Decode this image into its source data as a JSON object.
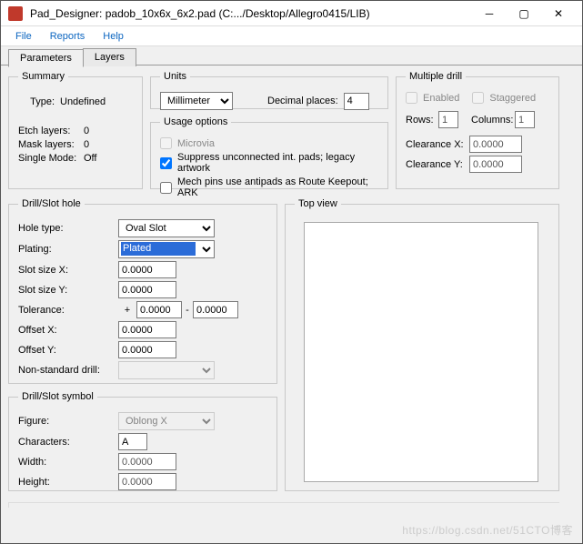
{
  "window": {
    "title": "Pad_Designer: padob_10x6x_6x2.pad (C:.../Desktop/Allegro0415/LIB)"
  },
  "menu": {
    "file": "File",
    "reports": "Reports",
    "help": "Help"
  },
  "tabs": {
    "parameters": "Parameters",
    "layers": "Layers"
  },
  "summary": {
    "legend": "Summary",
    "type_lbl": "Type:",
    "type_val": "Undefined",
    "etch_lbl": "Etch layers:",
    "etch_val": "0",
    "mask_lbl": "Mask layers:",
    "mask_val": "0",
    "single_lbl": "Single Mode:",
    "single_val": "Off"
  },
  "units": {
    "legend": "Units",
    "unit_val": "Millimeter",
    "dec_lbl": "Decimal places:",
    "dec_val": "4"
  },
  "usage": {
    "legend": "Usage options",
    "microvia": "Microvia",
    "suppress": "Suppress unconnected int. pads; legacy artwork",
    "mech": "Mech pins use antipads as Route Keepout; ARK"
  },
  "multi": {
    "legend": "Multiple drill",
    "enabled": "Enabled",
    "staggered": "Staggered",
    "rows_lbl": "Rows:",
    "rows_val": "1",
    "cols_lbl": "Columns:",
    "cols_val": "1",
    "clx_lbl": "Clearance X:",
    "clx_val": "0.0000",
    "cly_lbl": "Clearance Y:",
    "cly_val": "0.0000"
  },
  "drill": {
    "legend": "Drill/Slot hole",
    "hole_lbl": "Hole type:",
    "hole_val": "Oval Slot",
    "plating_lbl": "Plating:",
    "plating_val": "Plated",
    "sx_lbl": "Slot size X:",
    "sx_val": "0.0000",
    "sy_lbl": "Slot size Y:",
    "sy_val": "0.0000",
    "tol_lbl": "Tolerance:",
    "tol_plus": "+",
    "tol_p_val": "0.0000",
    "tol_dash": "-",
    "tol_m_val": "0.0000",
    "ox_lbl": "Offset X:",
    "ox_val": "0.0000",
    "oy_lbl": "Offset Y:",
    "oy_val": "0.0000",
    "nsd_lbl": "Non-standard drill:"
  },
  "symbol": {
    "legend": "Drill/Slot symbol",
    "figure_lbl": "Figure:",
    "figure_val": "Oblong X",
    "chars_lbl": "Characters:",
    "chars_val": "A",
    "width_lbl": "Width:",
    "width_val": "0.0000",
    "height_lbl": "Height:",
    "height_val": "0.0000"
  },
  "topview": {
    "legend": "Top view"
  },
  "watermark": "https://blog.csdn.net/51CTO博客"
}
